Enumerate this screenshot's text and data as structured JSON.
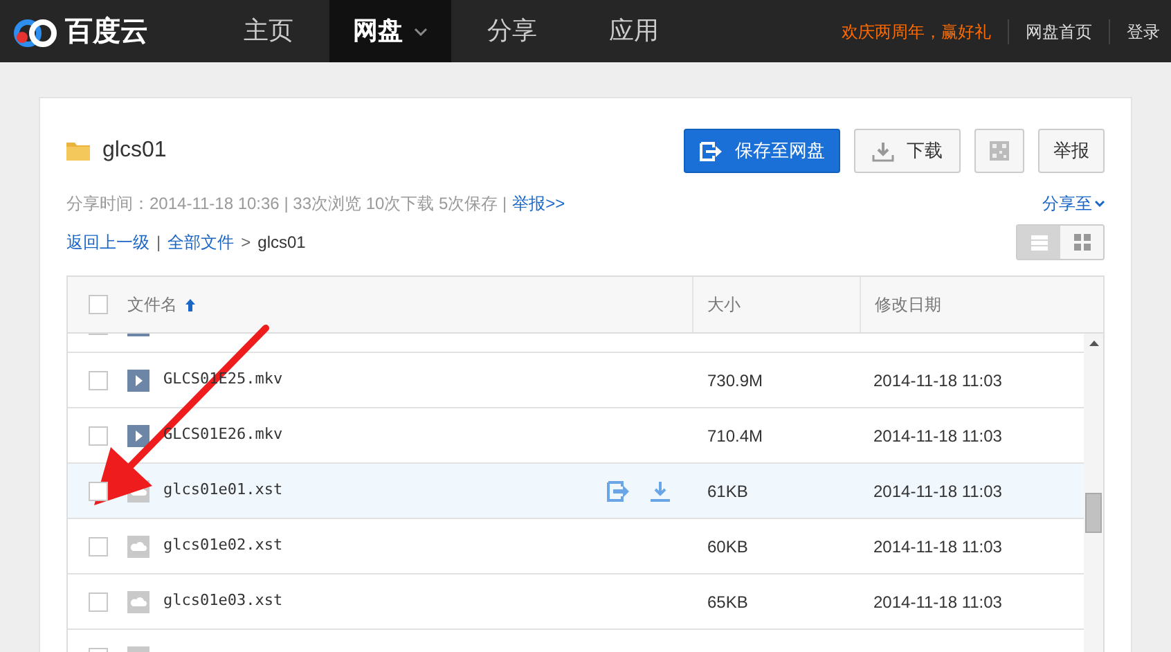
{
  "nav": {
    "logo": "百度云",
    "tabs": [
      {
        "label": "主页",
        "selected": false,
        "caret": false
      },
      {
        "label": "网盘",
        "selected": true,
        "caret": true
      },
      {
        "label": "分享",
        "selected": false,
        "caret": false
      },
      {
        "label": "应用",
        "selected": false,
        "caret": false
      }
    ],
    "promo": "欢庆两周年，赢好礼",
    "links": [
      "网盘首页",
      "登录"
    ]
  },
  "share": {
    "title": "glcs01",
    "buttons": [
      {
        "kind": "save",
        "label": "保存至网盘"
      },
      {
        "kind": "download",
        "label": "下载"
      },
      {
        "kind": "qr"
      },
      {
        "kind": "report",
        "label": "举报"
      }
    ],
    "meta": "分享时间：2014-11-18 10:36 | 33次浏览 10次下载 5次保存 |",
    "report_link": "举报>>",
    "share_to": "分享至",
    "breadcrumb": {
      "back": "返回上一级",
      "separator": "|",
      "all": "全部文件",
      "arrow": ">",
      "current": "glcs01"
    },
    "view_modes": [
      {
        "kind": "list",
        "selected": true
      },
      {
        "kind": "grid",
        "selected": false
      }
    ]
  },
  "table": {
    "header_checked": false,
    "columns": [
      {
        "label": "文件名",
        "sorted": true
      },
      {
        "label": "大小",
        "sorted": false
      },
      {
        "label": "修改日期",
        "sorted": false
      }
    ],
    "rows": [
      {
        "kind": "video",
        "checked": false,
        "highlighted": false
      },
      {
        "kind": "video",
        "name": "GLCS01E25.mkv",
        "size": "730.9M",
        "date": "2014-11-18 11:03",
        "checked": false,
        "highlighted": false
      },
      {
        "kind": "video",
        "name": "GLCS01E26.mkv",
        "size": "710.4M",
        "date": "2014-11-18 11:03",
        "checked": false,
        "highlighted": false
      },
      {
        "kind": "file",
        "name": "glcs01e01.xst",
        "size": "61KB",
        "date": "2014-11-18 11:03",
        "checked": false,
        "highlighted": true
      },
      {
        "kind": "file",
        "name": "glcs01e02.xst",
        "size": "60KB",
        "date": "2014-11-18 11:03",
        "checked": false,
        "highlighted": false
      },
      {
        "kind": "file",
        "name": "glcs01e03.xst",
        "size": "65KB",
        "date": "2014-11-18 11:03",
        "checked": false,
        "highlighted": false
      },
      {
        "kind": "file",
        "checked": false,
        "highlighted": false
      }
    ]
  }
}
